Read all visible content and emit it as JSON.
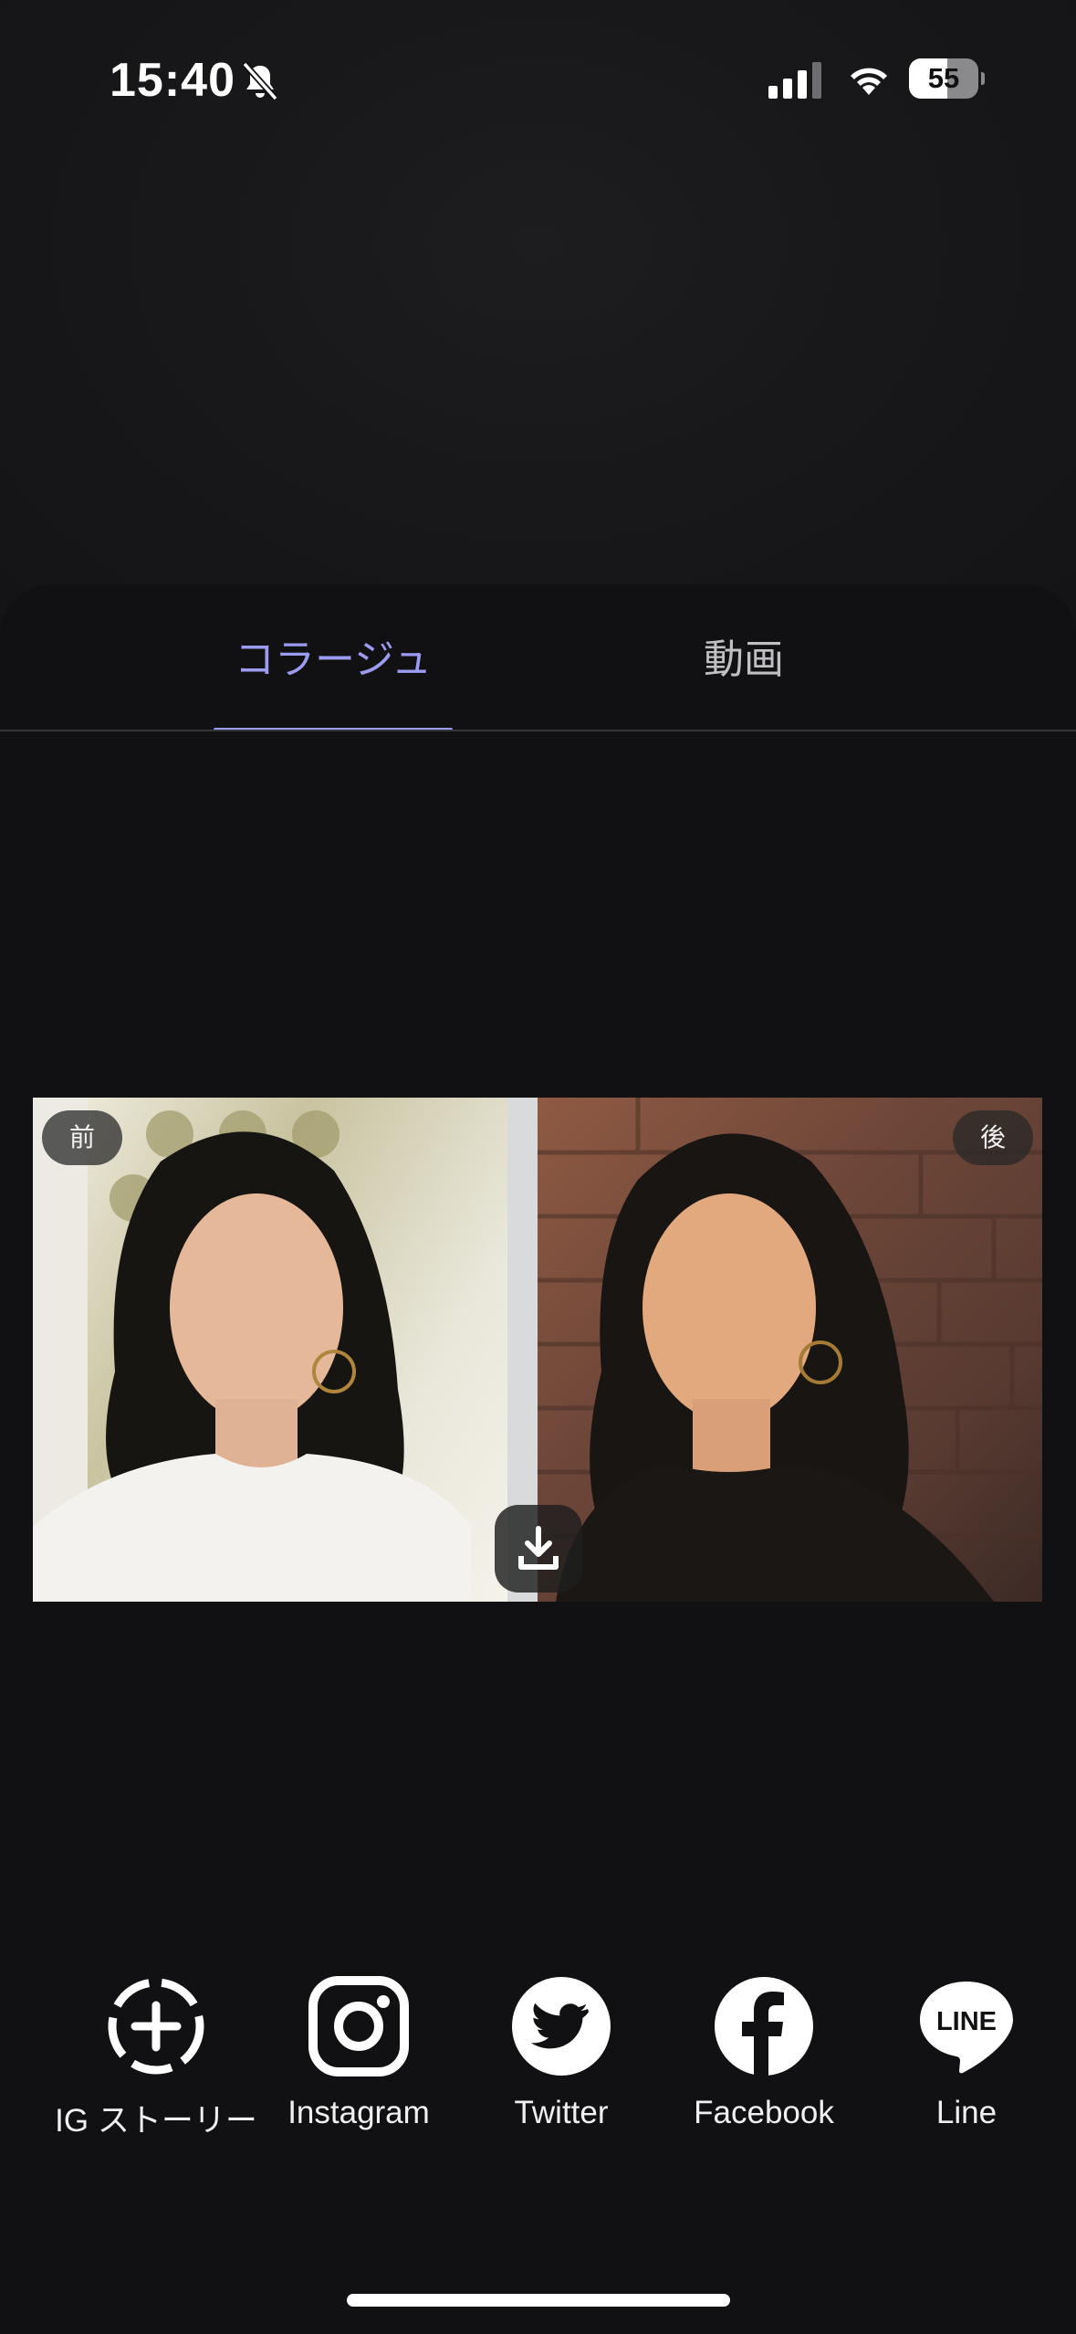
{
  "status": {
    "time": "15:40",
    "battery": "55",
    "battery_level": 0.55
  },
  "tabs": [
    {
      "label": "コラージュ",
      "active": true
    },
    {
      "label": "動画",
      "active": false
    }
  ],
  "collage": {
    "before_label": "前",
    "after_label": "後"
  },
  "share": [
    {
      "label": "IG ストーリー",
      "icon": "ig-story-icon"
    },
    {
      "label": "Instagram",
      "icon": "instagram-icon"
    },
    {
      "label": "Twitter",
      "icon": "twitter-icon"
    },
    {
      "label": "Facebook",
      "icon": "facebook-icon"
    },
    {
      "label": "Line",
      "icon": "line-icon"
    }
  ],
  "colors": {
    "accent": "#9b9cf0",
    "background": "#111114"
  }
}
